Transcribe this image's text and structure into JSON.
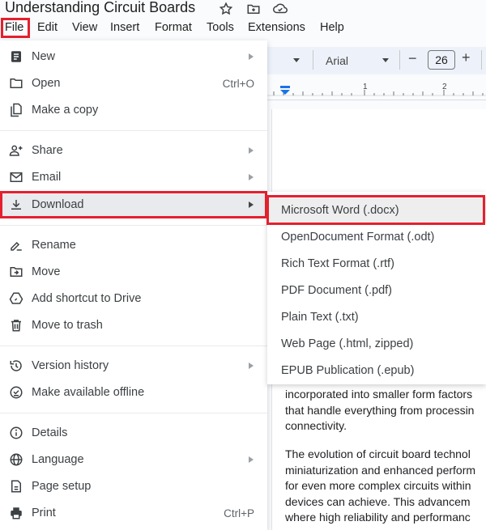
{
  "document": {
    "title": "Understanding Circuit Boards",
    "body_paragraphs": [
      [
        "incorporated into smaller form factors",
        "that handle everything from processin",
        "connectivity."
      ],
      [
        "The evolution of circuit board technol",
        "miniaturization and enhanced perform",
        "for even more complex circuits within",
        "devices can achieve. This advancem",
        "where high reliability and performanc"
      ]
    ]
  },
  "title_icons": [
    "star-icon",
    "move-to-folder-icon",
    "cloud-saved-icon"
  ],
  "menubar": {
    "items": [
      "File",
      "Edit",
      "View",
      "Insert",
      "Format",
      "Tools",
      "Extensions",
      "Help"
    ],
    "active": "File"
  },
  "toolbar": {
    "font_name": "Arial",
    "font_size": "26",
    "decrease_label": "−",
    "increase_label": "+"
  },
  "ruler": {
    "marks": [
      "1",
      "2"
    ]
  },
  "file_menu": {
    "groups": [
      [
        {
          "label": "New",
          "icon": "new-document-icon",
          "submenu": true
        },
        {
          "label": "Open",
          "icon": "folder-icon",
          "shortcut": "Ctrl+O"
        },
        {
          "label": "Make a copy",
          "icon": "copy-icon"
        }
      ],
      [
        {
          "label": "Share",
          "icon": "share-person-icon",
          "submenu": true
        },
        {
          "label": "Email",
          "icon": "email-icon",
          "submenu": true
        },
        {
          "label": "Download",
          "icon": "download-icon",
          "submenu": true,
          "active": true
        }
      ],
      [
        {
          "label": "Rename",
          "icon": "rename-icon"
        },
        {
          "label": "Move",
          "icon": "move-folder-icon"
        },
        {
          "label": "Add shortcut to Drive",
          "icon": "drive-shortcut-icon"
        },
        {
          "label": "Move to trash",
          "icon": "trash-icon"
        }
      ],
      [
        {
          "label": "Version history",
          "icon": "history-icon",
          "submenu": true
        },
        {
          "label": "Make available offline",
          "icon": "offline-icon"
        }
      ],
      [
        {
          "label": "Details",
          "icon": "info-icon"
        },
        {
          "label": "Language",
          "icon": "globe-icon",
          "submenu": true
        },
        {
          "label": "Page setup",
          "icon": "page-setup-icon"
        },
        {
          "label": "Print",
          "icon": "print-icon",
          "shortcut": "Ctrl+P"
        }
      ]
    ]
  },
  "download_submenu": {
    "items": [
      "Microsoft Word (.docx)",
      "OpenDocument Format (.odt)",
      "Rich Text Format (.rtf)",
      "PDF Document (.pdf)",
      "Plain Text (.txt)",
      "Web Page (.html, zipped)",
      "EPUB Publication (.epub)"
    ],
    "highlighted": "Microsoft Word (.docx)"
  },
  "colors": {
    "highlight_box": "#e5202e",
    "ruler_marker": "#1a73e8"
  }
}
